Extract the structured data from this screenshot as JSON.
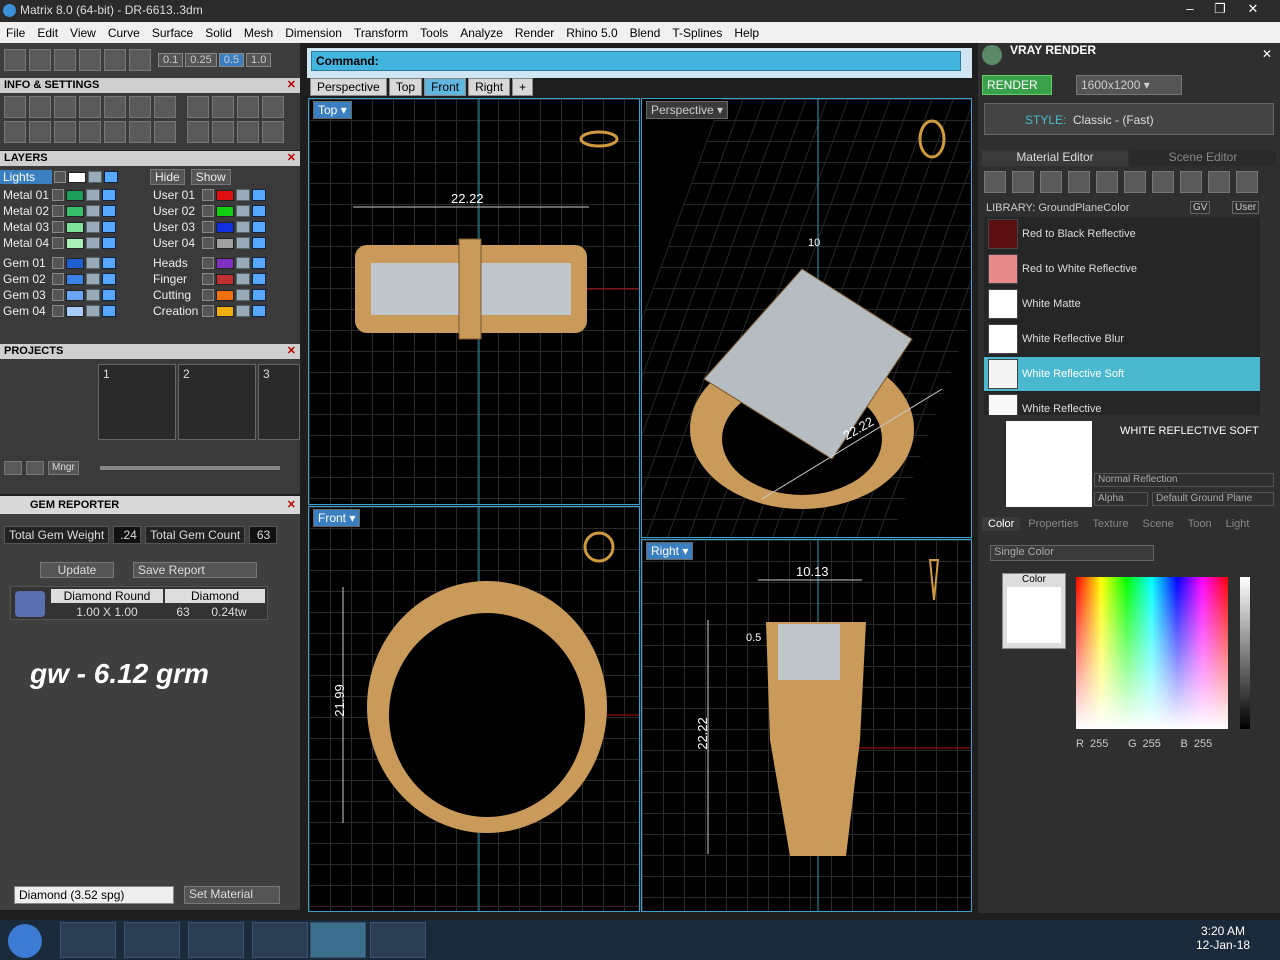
{
  "window": {
    "title": "Matrix 8.0 (64-bit) - DR-6613..3dm"
  },
  "menu": [
    "File",
    "Edit",
    "View",
    "Curve",
    "Surface",
    "Solid",
    "Mesh",
    "Dimension",
    "Transform",
    "Tools",
    "Analyze",
    "Render",
    "Rhino 5.0",
    "Blend",
    "T-Splines",
    "Help"
  ],
  "toolbar": {
    "presets": [
      "0.1",
      "0.25",
      "0.5",
      "1.0"
    ]
  },
  "info": {
    "title": "INFO & SETTINGS"
  },
  "layers": {
    "title": "LAYERS",
    "hide": "Hide",
    "show": "Show",
    "top": {
      "name": "Lights",
      "color": "#ffffff"
    },
    "left": [
      {
        "name": "Metal 01",
        "color": "#1a9e5a"
      },
      {
        "name": "Metal 02",
        "color": "#39c06b"
      },
      {
        "name": "Metal 03",
        "color": "#7fe29a"
      },
      {
        "name": "Metal 04",
        "color": "#a8f0b8"
      },
      {
        "name": "Gem 01",
        "color": "#1e5fd0"
      },
      {
        "name": "Gem 02",
        "color": "#3c82e6"
      },
      {
        "name": "Gem 03",
        "color": "#6aa6f5"
      },
      {
        "name": "Gem 04",
        "color": "#a8cdfa"
      }
    ],
    "right": [
      {
        "name": "User 01",
        "color": "#e01010"
      },
      {
        "name": "User 02",
        "color": "#10d010"
      },
      {
        "name": "User 03",
        "color": "#1030e0"
      },
      {
        "name": "User 04",
        "color": "#a0a0a0"
      },
      {
        "name": "Heads",
        "color": "#8030c0"
      },
      {
        "name": "Finger",
        "color": "#c03030"
      },
      {
        "name": "Cutting",
        "color": "#f07010"
      },
      {
        "name": "Creation",
        "color": "#f0b010"
      }
    ]
  },
  "projects": {
    "title": "PROJECTS",
    "slots": [
      "1",
      "2",
      "3"
    ],
    "mngr": "Mngr"
  },
  "gem": {
    "title": "GEM REPORTER",
    "weight_label": "Total Gem Weight",
    "weight": ".24",
    "count_label": "Total Gem Count",
    "count": "63",
    "update": "Update",
    "save": "Save Report",
    "table": {
      "h1": "Diamond Round",
      "h2": "Diamond",
      "size": "1.00 X 1.00",
      "qty": "63",
      "tw": "0.24tw"
    },
    "note": "gw - 6.12 grm",
    "material": "Diamond    (3.52 spg)",
    "set_material": "Set Material"
  },
  "command": {
    "label": "Command:",
    "value": ""
  },
  "tabs": [
    "Perspective",
    "Top",
    "Front",
    "Right",
    "+"
  ],
  "viewports": {
    "top": "Top",
    "perspective": "Perspective",
    "front": "Front",
    "right": "Right"
  },
  "dims": {
    "top_width": "22.22",
    "front_height": "21.99",
    "right_width": "10.13",
    "right_height": "22.22",
    "persp_len": "22.22",
    "persp_small": "10",
    "right_small": "0.5"
  },
  "vray": {
    "title": "VRAY RENDER",
    "render": "RENDER",
    "res": "1600x1200",
    "style_label": "STYLE:",
    "style": "Classic - (Fast)",
    "tabs": [
      "Material Editor",
      "Scene Editor"
    ],
    "library": "LIBRARY: GroundPlaneColor",
    "gv": "GV",
    "user": "User",
    "materials": [
      {
        "name": "Red to Black Reflective",
        "color": "#5a1010"
      },
      {
        "name": "Red to White Reflective",
        "color": "#e88a8a"
      },
      {
        "name": "White Matte",
        "color": "#ffffff"
      },
      {
        "name": "White Reflective Blur",
        "color": "#ffffff"
      },
      {
        "name": "White Reflective Soft",
        "color": "#f4f4f4"
      },
      {
        "name": "White Reflective",
        "color": "#f8f8f8"
      }
    ],
    "selected_name": "WHITE REFLECTIVE SOFT",
    "reflection": "Normal Reflection",
    "alpha": "Alpha",
    "ground": "Default Ground Plane",
    "subtabs": [
      "Color",
      "Properties",
      "Texture",
      "Scene",
      "Toon",
      "Light"
    ],
    "color_mode": "Single Color",
    "color_label": "Color",
    "r": "255",
    "g": "255",
    "b": "255",
    "rl": "R",
    "gl": "G",
    "bl": "B"
  },
  "taskbar": {
    "time": "3:20 AM",
    "date": "12-Jan-18"
  }
}
